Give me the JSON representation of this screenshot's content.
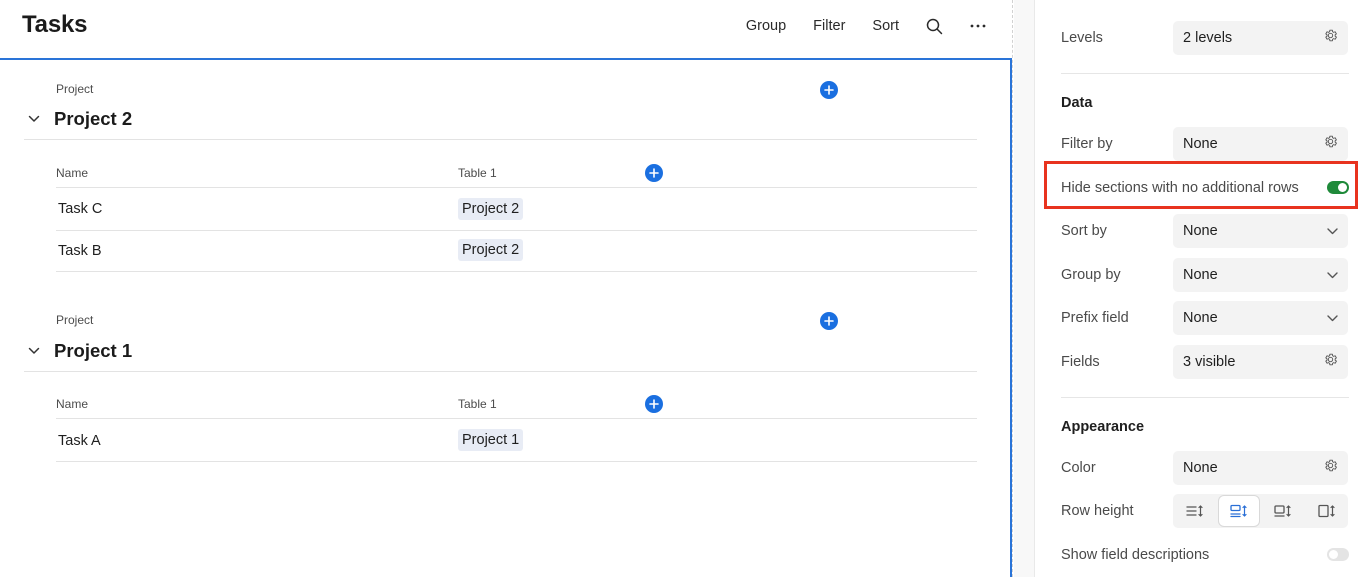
{
  "page": {
    "title": "Tasks",
    "toolbar": {
      "group": "Group",
      "filter": "Filter",
      "sort": "Sort"
    }
  },
  "groups": [
    {
      "label": "Project",
      "title": "Project 2",
      "columns": [
        "Name",
        "Table 1"
      ],
      "rows": [
        {
          "name": "Task C",
          "table": "Project 2"
        },
        {
          "name": "Task B",
          "table": "Project 2"
        }
      ]
    },
    {
      "label": "Project",
      "title": "Project 1",
      "columns": [
        "Name",
        "Table 1"
      ],
      "rows": [
        {
          "name": "Task A",
          "table": "Project 1"
        }
      ]
    }
  ],
  "panel": {
    "hierarchy": {
      "levels_label": "Levels",
      "levels_value": "2 levels"
    },
    "data": {
      "heading": "Data",
      "filter_label": "Filter by",
      "filter_value": "None",
      "hide_label": "Hide sections with no additional rows",
      "hide_enabled": true,
      "sort_label": "Sort by",
      "sort_value": "None",
      "group_label": "Group by",
      "group_value": "None",
      "prefix_label": "Prefix field",
      "prefix_value": "None",
      "fields_label": "Fields",
      "fields_value": "3 visible"
    },
    "appearance": {
      "heading": "Appearance",
      "color_label": "Color",
      "color_value": "None",
      "row_height_label": "Row height",
      "show_desc_label": "Show field descriptions",
      "show_desc_enabled": false
    }
  },
  "colors": {
    "accent_blue": "#1a6fe0",
    "toggle_on": "#1f8a3a",
    "highlight_red": "#e8331f"
  }
}
